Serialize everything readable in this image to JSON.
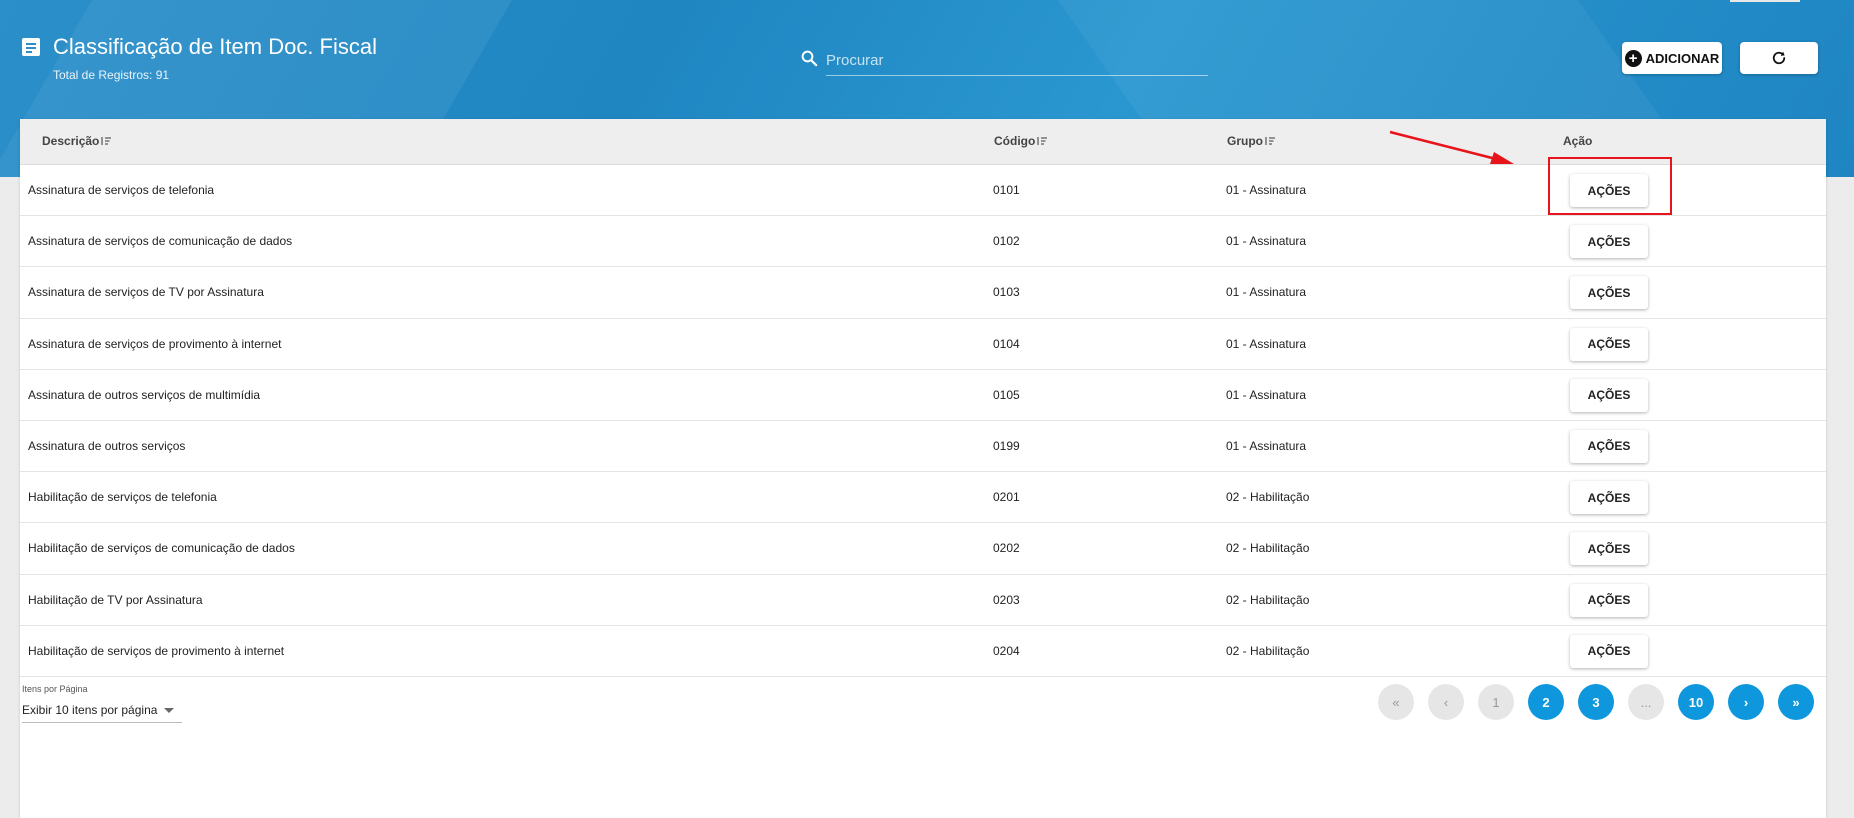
{
  "header": {
    "title": "Classificação de Item Doc. Fiscal",
    "record_count": "Total de Registros: 91",
    "title_icon": "document-icon",
    "search_placeholder": "Procurar",
    "add_label": "ADICIONAR",
    "refresh_icon": "refresh-icon"
  },
  "table": {
    "columns": [
      "Descrição",
      "Código",
      "Grupo",
      "Ação"
    ],
    "rows": [
      {
        "descricao": "Assinatura de serviços de telefonia",
        "codigo": "0101",
        "grupo": "01 - Assinatura",
        "acao": "AÇÕES"
      },
      {
        "descricao": "Assinatura de serviços de comunicação de dados",
        "codigo": "0102",
        "grupo": "01 - Assinatura",
        "acao": "AÇÕES"
      },
      {
        "descricao": "Assinatura de serviços de TV por Assinatura",
        "codigo": "0103",
        "grupo": "01 - Assinatura",
        "acao": "AÇÕES"
      },
      {
        "descricao": "Assinatura de serviços de provimento à internet",
        "codigo": "0104",
        "grupo": "01 - Assinatura",
        "acao": "AÇÕES"
      },
      {
        "descricao": "Assinatura de outros serviços de multimídia",
        "codigo": "0105",
        "grupo": "01 - Assinatura",
        "acao": "AÇÕES"
      },
      {
        "descricao": "Assinatura de outros serviços",
        "codigo": "0199",
        "grupo": "01 - Assinatura",
        "acao": "AÇÕES"
      },
      {
        "descricao": "Habilitação de serviços de telefonia",
        "codigo": "0201",
        "grupo": "02 - Habilitação",
        "acao": "AÇÕES"
      },
      {
        "descricao": "Habilitação de serviços de comunicação de dados",
        "codigo": "0202",
        "grupo": "02 - Habilitação",
        "acao": "AÇÕES"
      },
      {
        "descricao": "Habilitação de TV por Assinatura",
        "codigo": "0203",
        "grupo": "02 - Habilitação",
        "acao": "AÇÕES"
      },
      {
        "descricao": "Habilitação de serviços de provimento à internet",
        "codigo": "0204",
        "grupo": "02 - Habilitação",
        "acao": "AÇÕES"
      }
    ]
  },
  "footer": {
    "items_per_page_label": "Itens por Página",
    "items_per_page_value": "Exibir 10 itens por página",
    "pagination": {
      "first": "«",
      "prev": "‹",
      "pages": [
        "1",
        "2",
        "3",
        "...",
        "10"
      ],
      "next": "›",
      "last": "»",
      "current_page": "1"
    }
  },
  "colors": {
    "header_blue": "#2b8fc9",
    "page_active": "#0e97dc",
    "annotation_red": "#e8141b"
  }
}
